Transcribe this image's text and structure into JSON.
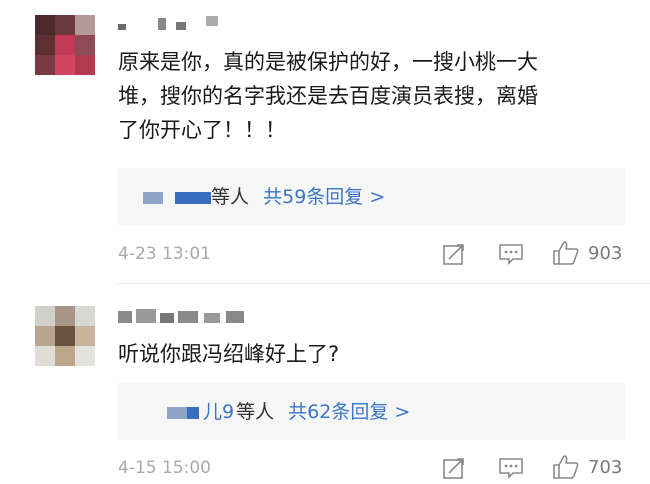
{
  "comments": [
    {
      "text_lines": [
        "原来是你，真的是被保护的好，一搜小桃一大",
        "堆，搜你的名字我还是去百度演员表搜，离婚",
        "了你开心了！！！"
      ],
      "reply_summary": {
        "others": "等人",
        "link": "共59条回复 >"
      },
      "time": "4-23 13:01",
      "likes": "903"
    },
    {
      "text_lines": [
        "听说你跟冯绍峰好上了?"
      ],
      "reply_summary": {
        "partial_name": "儿9",
        "others": "等人",
        "link": "共62条回复 >"
      },
      "time": "4-15 15:00",
      "likes": "703"
    }
  ]
}
